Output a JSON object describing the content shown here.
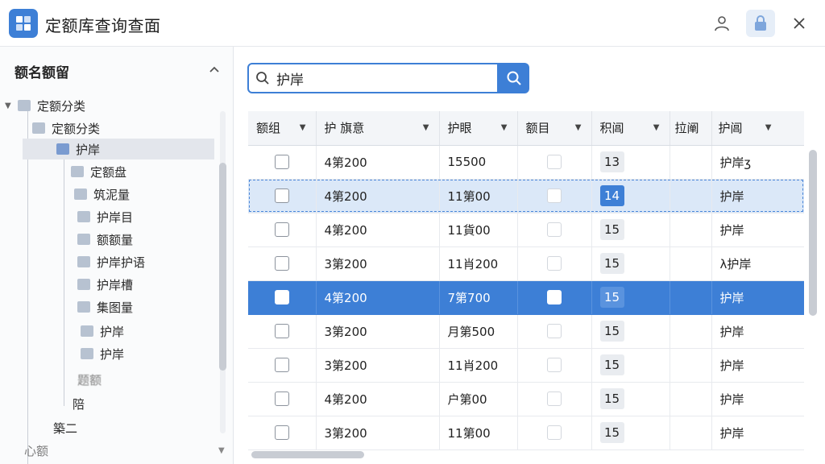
{
  "window": {
    "title": "定额库查询查面"
  },
  "left_panel": {
    "title": "额名额留",
    "tree": [
      {
        "label": "定额分类",
        "level": 0,
        "expanded": true
      },
      {
        "label": "定额分类",
        "level": 1
      },
      {
        "label": "护岸",
        "level": 2,
        "selected": true
      },
      {
        "label": "定额盘",
        "level": 3
      },
      {
        "label": "筑泥量",
        "level": 3
      },
      {
        "label": "护岸目",
        "level": 3
      },
      {
        "label": "额额量",
        "level": 3
      },
      {
        "label": "护岸护语",
        "level": 3
      },
      {
        "label": "护岸槽",
        "level": 3
      },
      {
        "label": "集图量",
        "level": 3
      },
      {
        "label": "护岸",
        "level": 3
      },
      {
        "label": "护岸",
        "level": 3
      },
      {
        "label": "题额",
        "level": 3,
        "faded": true
      },
      {
        "label": "陪",
        "level": 3
      },
      {
        "label": "築二",
        "level": 1
      },
      {
        "label": "心额",
        "level": 0,
        "faded": true
      }
    ]
  },
  "search": {
    "value": "护岸",
    "placeholder": ""
  },
  "table": {
    "columns": [
      "额组",
      "护 旗意",
      "护眼",
      "额目",
      "积阊",
      "拉阐",
      "护阊"
    ],
    "rows": [
      {
        "c1": "4第200",
        "c2": "15500",
        "num": "13",
        "last": "护岸ʒ",
        "state": "normal"
      },
      {
        "c1": "4第200",
        "c2": "11第00",
        "num": "14",
        "last": "护岸",
        "state": "highlight"
      },
      {
        "c1": "4第200",
        "c2": "11貨00",
        "num": "15",
        "last": "护岸",
        "state": "normal"
      },
      {
        "c1": "3第200",
        "c2": "11肖200",
        "num": "15",
        "last": "λ护岸",
        "state": "normal"
      },
      {
        "c1": "4第200",
        "c2": "7第700",
        "num": "15",
        "last": "护岸",
        "state": "selected"
      },
      {
        "c1": "3第200",
        "c2": "月第500",
        "num": "15",
        "last": "护岸",
        "state": "normal"
      },
      {
        "c1": "3第200",
        "c2": "11肖200",
        "num": "15",
        "last": "护岸",
        "state": "normal"
      },
      {
        "c1": "4第200",
        "c2": "户第00",
        "num": "15",
        "last": "护岸",
        "state": "normal"
      },
      {
        "c1": "3第200",
        "c2": "11第00",
        "num": "15",
        "last": "护岸",
        "state": "normal"
      }
    ]
  },
  "colors": {
    "accent": "#3d7fd6",
    "selected_row": "#3d7fd6",
    "highlight_row": "#dbe8f8"
  }
}
